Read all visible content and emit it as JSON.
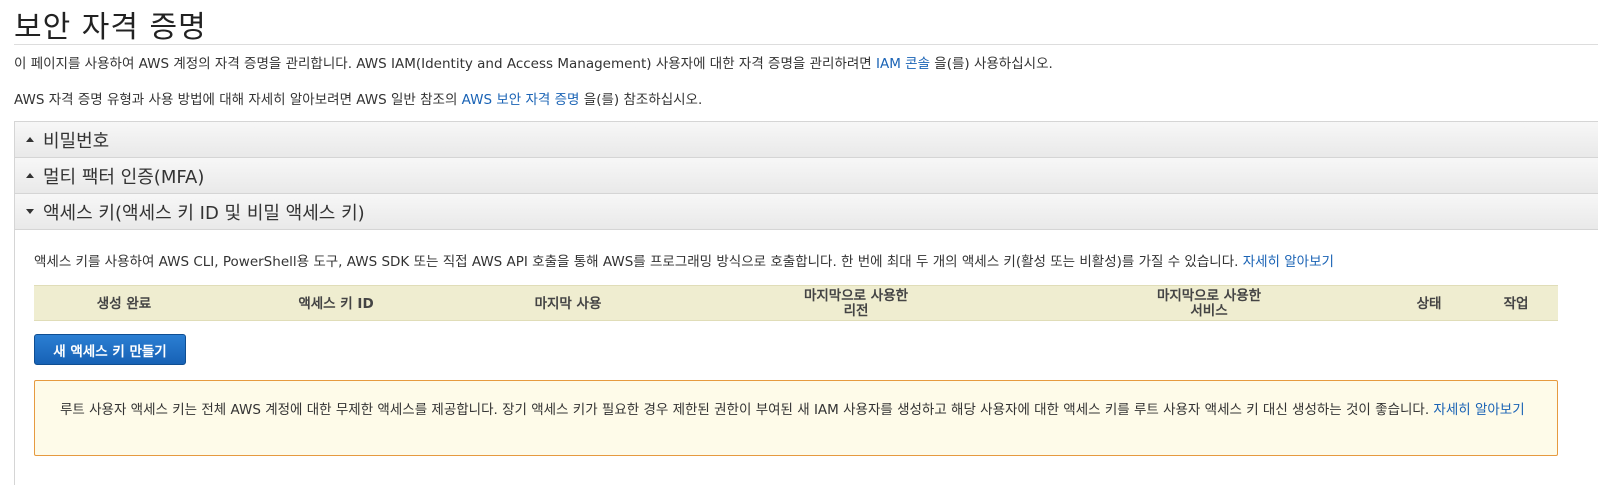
{
  "page": {
    "title": "보안 자격 증명",
    "intro1": {
      "before": "이 페이지를 사용하여 AWS 계정의 자격 증명을 관리합니다. AWS IAM(Identity and Access Management) 사용자에 대한 자격 증명을 관리하려면 ",
      "link": "IAM 콘솔",
      "after": " 을(를) 사용하십시오."
    },
    "intro2": {
      "before": "AWS 자격 증명 유형과 사용 방법에 대해 자세히 알아보려면 AWS 일반 참조의 ",
      "link": "AWS 보안 자격 증명",
      "after": " 을(를) 참조하십시오."
    }
  },
  "sections": {
    "password": {
      "label": "비밀번호",
      "expanded": false
    },
    "mfa": {
      "label": "멀티 팩터 인증(MFA)",
      "expanded": false
    },
    "access_keys": {
      "label": "액세스 키(액세스 키 ID 및 비밀 액세스 키)",
      "expanded": true
    }
  },
  "access_keys": {
    "description": "액세스 키를 사용하여 AWS CLI, PowerShell용 도구, AWS SDK 또는 직접 AWS API 호출을 통해 AWS를 프로그래밍 방식으로 호출합니다. 한 번에 최대 두 개의 액세스 키(활성 또는 비활성)를 가질 수 있습니다. ",
    "learn_more": "자세히 알아보기",
    "columns": {
      "created": "생성 완료",
      "key_id": "액세스 키 ID",
      "last_used": "마지막 사용",
      "last_region_1": "마지막으로 사용한",
      "last_region_2": "리전",
      "last_service_1": "마지막으로 사용한",
      "last_service_2": "서비스",
      "status": "상태",
      "actions": "작업"
    },
    "create_button": "새 액세스 키 만들기",
    "warning": {
      "text": "루트 사용자 액세스 키는 전체 AWS 계정에 대한 무제한 액세스를 제공합니다. 장기 액세스 키가 필요한 경우 제한된 권한이 부여된 새 IAM 사용자를 생성하고 해당 사용자에 대한 액세스 키를 루트 사용자 액세스 키 대신 생성하는 것이 좋습니다. ",
      "link": "자세히 알아보기"
    }
  },
  "colors": {
    "link": "#1a63b5",
    "button": "#1762b5",
    "table_header": "#efedd0",
    "warning_border": "#e69a3f",
    "warning_bg": "#fefbe9"
  }
}
